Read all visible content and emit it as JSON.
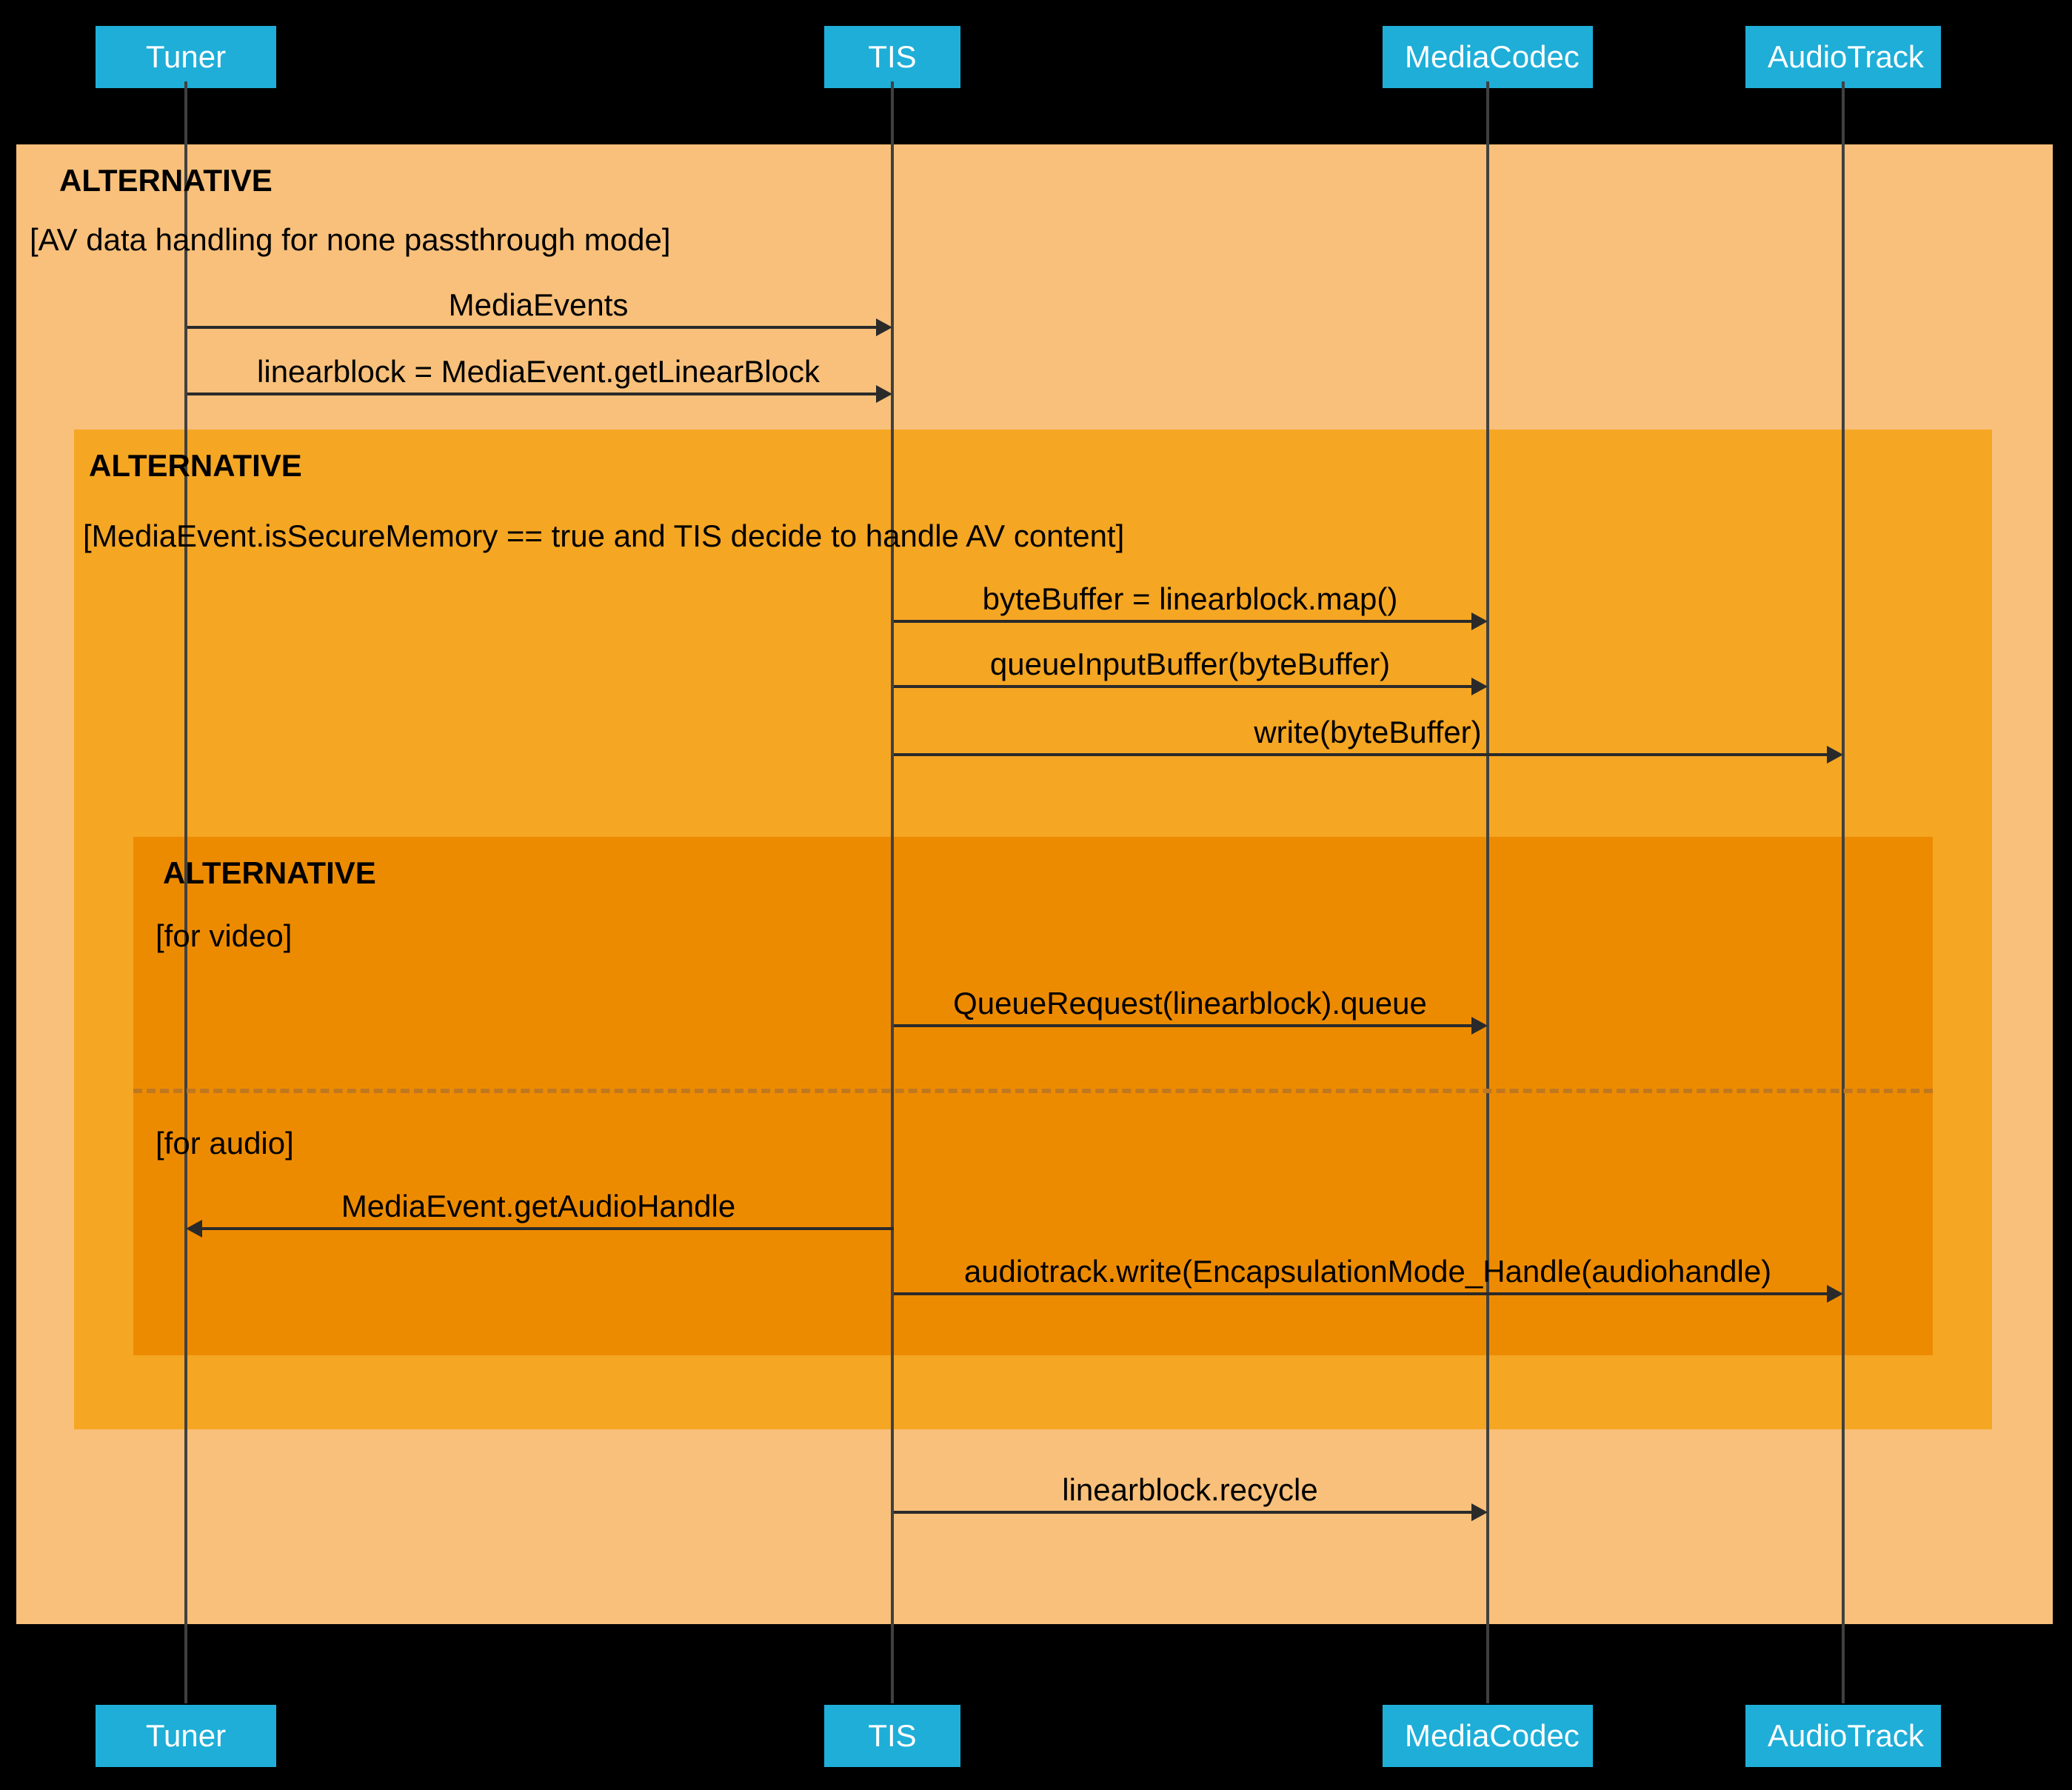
{
  "participants": {
    "tuner": "Tuner",
    "tis": "TIS",
    "mediacodec": "MediaCodec",
    "audiotrack": "AudioTrack"
  },
  "alt1": {
    "header": "ALTERNATIVE",
    "condition": "[AV data handling for none passthrough mode]"
  },
  "alt2": {
    "header": "ALTERNATIVE",
    "condition": "[MediaEvent.isSecureMemory == true and TIS decide to handle AV content]"
  },
  "alt3": {
    "header": "ALTERNATIVE",
    "condition_video": "[for video]",
    "condition_audio": "[for audio]"
  },
  "messages": {
    "m1": "MediaEvents",
    "m2": "linearblock = MediaEvent.getLinearBlock",
    "m3": "byteBuffer = linearblock.map()",
    "m4": "queueInputBuffer(byteBuffer)",
    "m5": "write(byteBuffer)",
    "m6": "QueueRequest(linearblock).queue",
    "m7": "MediaEvent.getAudioHandle",
    "m8": "audiotrack.write(EncapsulationMode_Handle(audiohandle)",
    "m9": "linearblock.recycle"
  }
}
